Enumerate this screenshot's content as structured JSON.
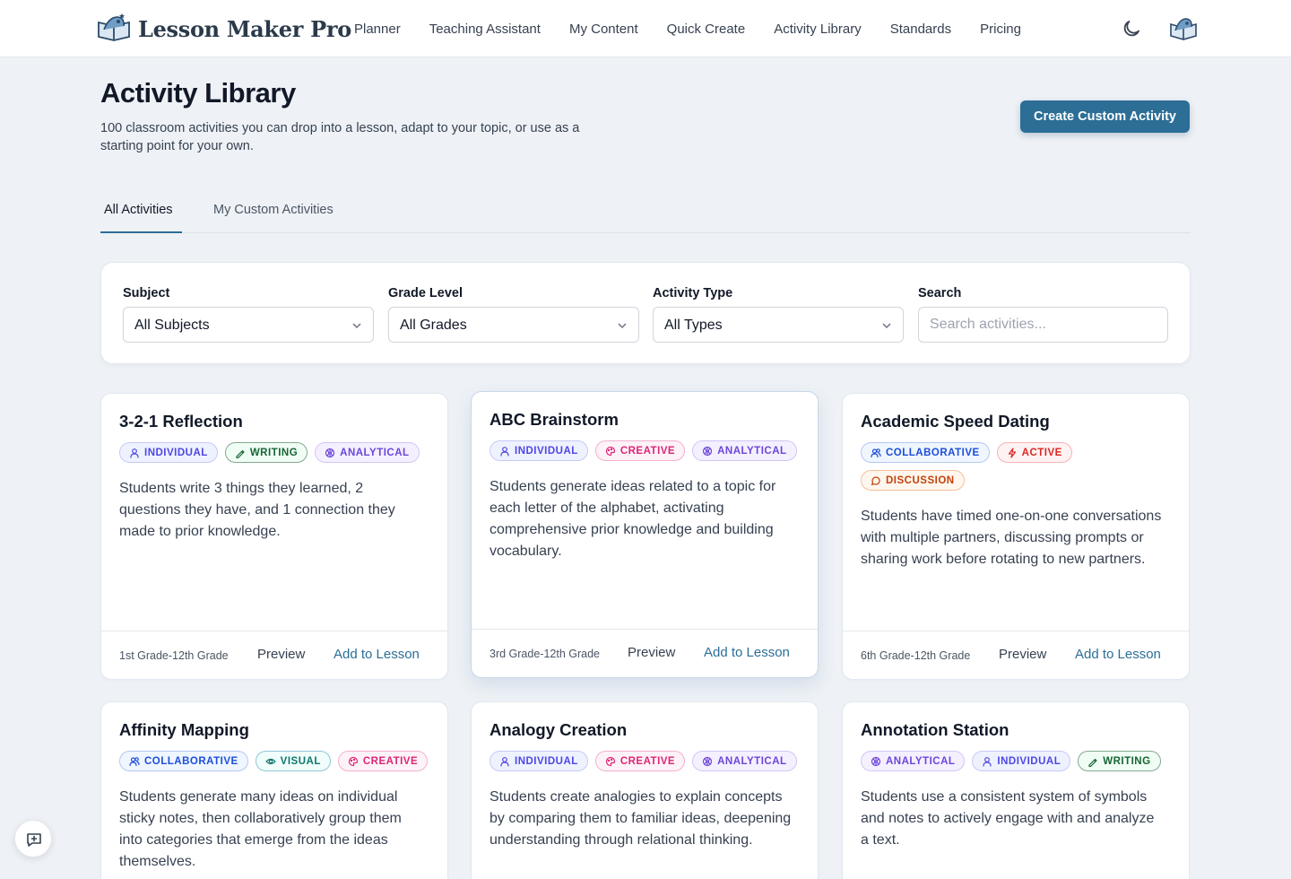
{
  "brand": {
    "name": "Lesson Maker Pro"
  },
  "nav": [
    "Planner",
    "Teaching Assistant",
    "My Content",
    "Quick Create",
    "Activity Library",
    "Standards",
    "Pricing"
  ],
  "page": {
    "title": "Activity Library",
    "description": "100 classroom activities you can drop into a lesson, adapt to your topic, or use as a starting point for your own.",
    "create_button": "Create Custom Activity"
  },
  "tabs": [
    "All Activities",
    "My Custom Activities"
  ],
  "filters": {
    "subject": {
      "label": "Subject",
      "value": "All Subjects"
    },
    "grade": {
      "label": "Grade Level",
      "value": "All Grades"
    },
    "type": {
      "label": "Activity Type",
      "value": "All Types"
    },
    "search": {
      "label": "Search",
      "placeholder": "Search activities..."
    }
  },
  "card_actions": {
    "preview": "Preview",
    "add": "Add to Lesson"
  },
  "icons": {
    "individual": "user-icon",
    "writing": "pen-icon",
    "analytical": "brain-icon",
    "creative": "palette-icon",
    "collaborative": "users-icon",
    "active": "bolt-icon",
    "discussion": "chat-icon",
    "visual": "eye-icon"
  },
  "colors": {
    "accent": "#2c6e96"
  },
  "cards": [
    {
      "title": "3-2-1 Reflection",
      "tags": [
        "Individual",
        "Writing",
        "Analytical"
      ],
      "description": "Students write 3 things they learned, 2 questions they have, and 1 connection they made to prior knowledge.",
      "grade": "1st Grade-12th Grade"
    },
    {
      "title": "ABC Brainstorm",
      "tags": [
        "Individual",
        "Creative",
        "Analytical"
      ],
      "description": "Students generate ideas related to a topic for each letter of the alphabet, activating comprehensive prior knowledge and building vocabulary.",
      "grade": "3rd Grade-12th Grade"
    },
    {
      "title": "Academic Speed Dating",
      "tags": [
        "Collaborative",
        "Active",
        "Discussion"
      ],
      "description": "Students have timed one-on-one conversations with multiple partners, discussing prompts or sharing work before rotating to new partners.",
      "grade": "6th Grade-12th Grade"
    },
    {
      "title": "Affinity Mapping",
      "tags": [
        "Collaborative",
        "Visual",
        "Creative"
      ],
      "description": "Students generate many ideas on individual sticky notes, then collaboratively group them into categories that emerge from the ideas themselves."
    },
    {
      "title": "Analogy Creation",
      "tags": [
        "Individual",
        "Creative",
        "Analytical"
      ],
      "description": "Students create analogies to explain concepts by comparing them to familiar ideas, deepening understanding through relational thinking."
    },
    {
      "title": "Annotation Station",
      "tags": [
        "Analytical",
        "Individual",
        "Writing"
      ],
      "description": "Students use a consistent system of symbols and notes to actively engage with and analyze a text."
    }
  ]
}
